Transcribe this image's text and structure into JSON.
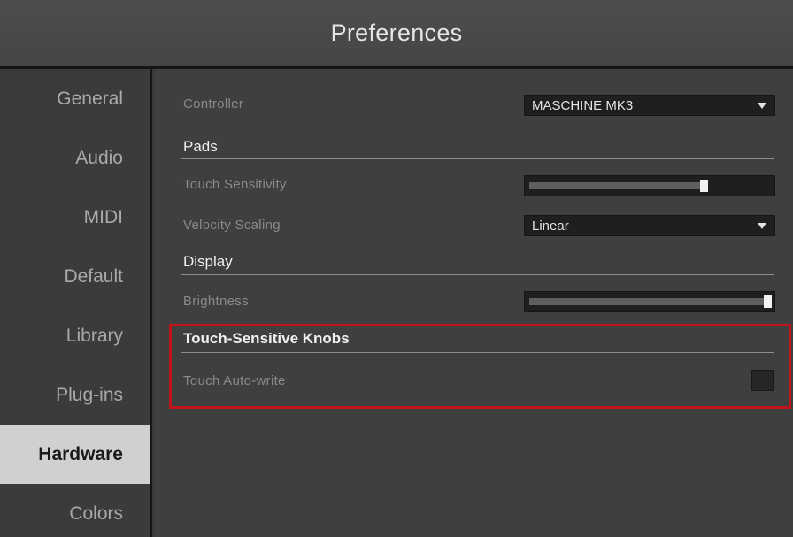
{
  "window": {
    "title": "Preferences"
  },
  "sidebar": {
    "items": [
      {
        "label": "General",
        "active": false
      },
      {
        "label": "Audio",
        "active": false
      },
      {
        "label": "MIDI",
        "active": false
      },
      {
        "label": "Default",
        "active": false
      },
      {
        "label": "Library",
        "active": false
      },
      {
        "label": "Plug-ins",
        "active": false
      },
      {
        "label": "Hardware",
        "active": true
      },
      {
        "label": "Colors",
        "active": false
      }
    ]
  },
  "hardware": {
    "controller": {
      "label": "Controller",
      "value": "MASCHINE MK3"
    },
    "pads": {
      "title": "Pads",
      "touch_sensitivity": {
        "label": "Touch Sensitivity",
        "level": 0.73
      },
      "velocity_scaling": {
        "label": "Velocity Scaling",
        "value": "Linear"
      }
    },
    "display": {
      "title": "Display",
      "brightness": {
        "label": "Brightness",
        "level": 1.0
      }
    },
    "touch_knobs": {
      "title": "Touch-Sensitive Knobs",
      "auto_write": {
        "label": "Touch Auto-write",
        "checked": false
      }
    }
  },
  "colors": {
    "highlight": "#c0141b",
    "active_nav_bg": "#d0d0d0"
  }
}
